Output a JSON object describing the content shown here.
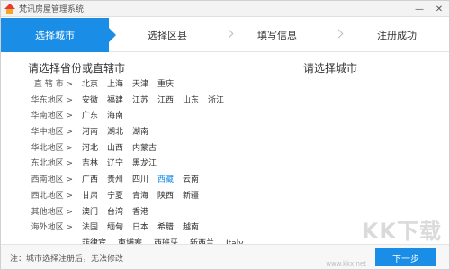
{
  "window": {
    "title": "梵讯房屋管理系统",
    "min_glyph": "—",
    "close_glyph": "✕"
  },
  "steps": [
    {
      "label": "选择城市",
      "active": true
    },
    {
      "label": "选择区县",
      "active": false
    },
    {
      "label": "填写信息",
      "active": false
    },
    {
      "label": "注册成功",
      "active": false
    }
  ],
  "left_panel": {
    "title": "请选择省份或直辖市",
    "rows": [
      {
        "label": "直 辖 市 >",
        "cities": [
          "北京",
          "上海",
          "天津",
          "重庆"
        ]
      },
      {
        "label": "华东地区 >",
        "cities": [
          "安徽",
          "福建",
          "江苏",
          "江西",
          "山东",
          "浙江"
        ]
      },
      {
        "label": "华南地区 >",
        "cities": [
          "广东",
          "海南"
        ]
      },
      {
        "label": "华中地区 >",
        "cities": [
          "河南",
          "湖北",
          "湖南"
        ]
      },
      {
        "label": "华北地区 >",
        "cities": [
          "河北",
          "山西",
          "内蒙古"
        ]
      },
      {
        "label": "东北地区 >",
        "cities": [
          "吉林",
          "辽宁",
          "黑龙江"
        ]
      },
      {
        "label": "西南地区 >",
        "cities": [
          "广西",
          "贵州",
          "四川",
          "西藏",
          "云南"
        ]
      },
      {
        "label": "西北地区 >",
        "cities": [
          "甘肃",
          "宁夏",
          "青海",
          "陕西",
          "新疆"
        ]
      },
      {
        "label": "其他地区 >",
        "cities": [
          "澳门",
          "台湾",
          "香港"
        ]
      },
      {
        "label": "海外地区 >",
        "cities": [
          "法国",
          "缅甸",
          "日本",
          "希腊",
          "越南"
        ]
      },
      {
        "label": "",
        "cities": [
          "菲律宾",
          "柬埔寨",
          "西班牙",
          "新西兰",
          "Italy"
        ]
      }
    ],
    "selected_city": "西藏"
  },
  "right_panel": {
    "title": "请选择城市"
  },
  "footer": {
    "note": "注：城市选择注册后，无法修改",
    "next_label": "下一步"
  },
  "watermark": {
    "text": "KK下载",
    "url": "www.kkx.net"
  },
  "colors": {
    "accent": "#1a8ee6",
    "selected_city": "#1a8ee6"
  }
}
